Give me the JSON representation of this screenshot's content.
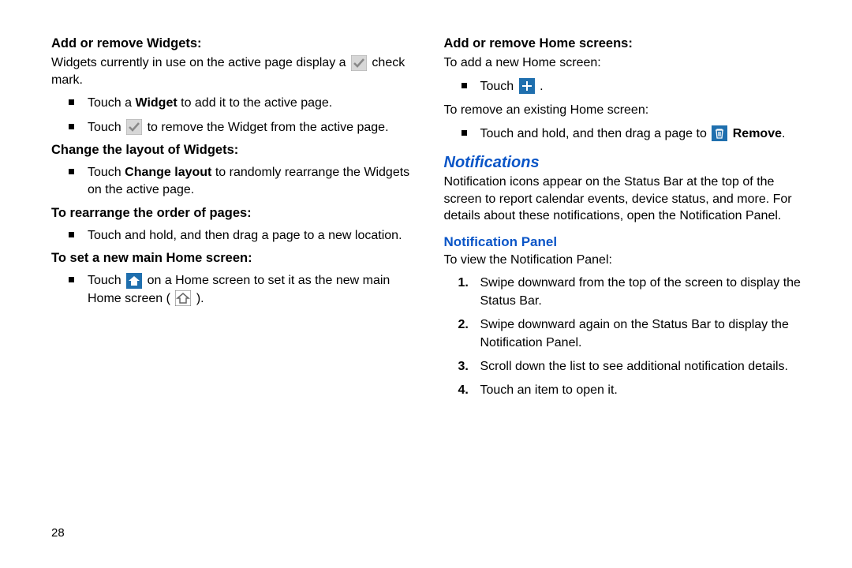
{
  "page_number": "28",
  "left": {
    "h1": "Add or remove Widgets:",
    "p1a": "Widgets currently in use on the active page display a ",
    "p1b": " check mark.",
    "b1a": "Touch a ",
    "b1b": "Widget",
    "b1c": " to add it to the active page.",
    "b2a": "Touch ",
    "b2b": " to remove the Widget from the active page.",
    "h2": "Change the layout of Widgets:",
    "b3a": "Touch ",
    "b3b": "Change layout",
    "b3c": " to randomly rearrange the Widgets on the active page.",
    "h3": "To rearrange the order of pages:",
    "b4": "Touch and hold, and then drag a page to a new location.",
    "h4": "To set a new main Home screen:",
    "b5a": "Touch ",
    "b5b": " on a Home screen to set it as the new main Home screen ( ",
    "b5c": " )."
  },
  "right": {
    "h1": "Add or remove Home screens:",
    "p1": "To add a new Home screen:",
    "b1a": "Touch ",
    "b1b": " .",
    "p2": "To remove an existing Home screen:",
    "b2a": "Touch and hold, and then drag a page to ",
    "b2b": " ",
    "b2c": "Remove",
    "b2d": ".",
    "sec": "Notifications",
    "secp": "Notification icons appear on the Status Bar at the top of the screen to report calendar events, device status, and more. For details about these notifications, open the Notification Panel.",
    "sub": "Notification Panel",
    "subp": "To view the Notification Panel:",
    "n1": "Swipe downward from the top of the screen to display the Status Bar.",
    "n2": "Swipe downward again on the Status Bar to display the Notification Panel.",
    "n3": "Scroll down the list to see additional notification details.",
    "n4": "Touch an item to open it.",
    "num1": "1.",
    "num2": "2.",
    "num3": "3.",
    "num4": "4."
  }
}
